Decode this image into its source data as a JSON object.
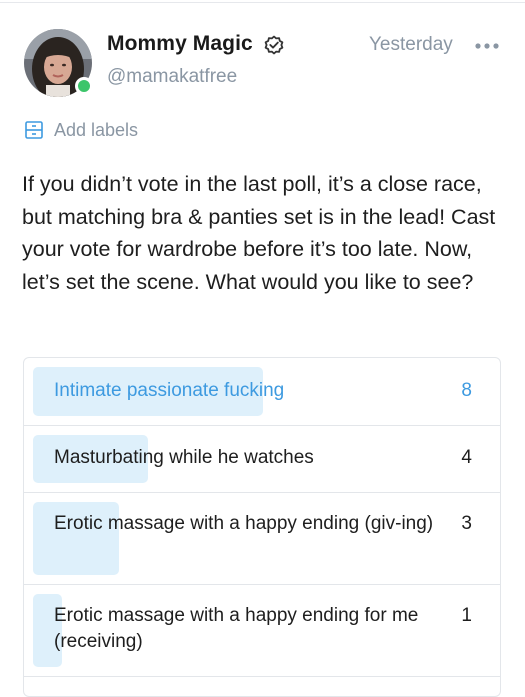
{
  "author": {
    "display_name": "Mommy Magic",
    "username": "@mamakatfree",
    "verified": true,
    "online": true
  },
  "post": {
    "timestamp": "Yesterday",
    "labels_action": "Add labels",
    "text": "If you didn’t vote in the last poll, it’s a close race, but matching bra & panties set is in the lead! Cast your vote for wardrobe before it’s too late. Now, let’s set the scene. What would you like to see?"
  },
  "poll": {
    "options": [
      {
        "label": "Intimate passionate fucking",
        "votes": "8",
        "share": 8
      },
      {
        "label": "Masturbating while he watches",
        "votes": "4",
        "share": 4
      },
      {
        "label": "Erotic massage with a happy ending (giv-ing)",
        "votes": "3",
        "share": 3
      },
      {
        "label": "Erotic massage with a happy ending for me (receiving)",
        "votes": "1",
        "share": 1
      }
    ]
  },
  "colors": {
    "accent": "#3d9ae0",
    "poll_fill": "#def0fb",
    "muted_text": "#8a96a3",
    "online": "#3cc56a"
  },
  "icons": {
    "verified": "verified-badge-icon",
    "more": "more-dots-icon",
    "labels": "label-tag-icon"
  }
}
